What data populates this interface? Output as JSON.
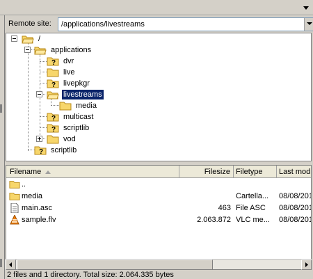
{
  "remote": {
    "label": "Remote site:",
    "path": "/applications/livestreams"
  },
  "tree": {
    "nodes": [
      {
        "label": "/",
        "icon": "folder-open-icon",
        "expanded": true
      },
      {
        "label": "applications",
        "icon": "folder-open-icon",
        "expanded": true
      },
      {
        "label": "dvr",
        "icon": "folder-unknown-icon"
      },
      {
        "label": "live",
        "icon": "folder-icon"
      },
      {
        "label": "livepkgr",
        "icon": "folder-unknown-icon"
      },
      {
        "label": "livestreams",
        "icon": "folder-open-icon",
        "expanded": true,
        "selected": true
      },
      {
        "label": "media",
        "icon": "folder-icon"
      },
      {
        "label": "multicast",
        "icon": "folder-unknown-icon"
      },
      {
        "label": "scriptlib",
        "icon": "folder-unknown-icon"
      },
      {
        "label": "vod",
        "icon": "folder-icon",
        "expanded": false
      },
      {
        "label": "scriptlib",
        "icon": "folder-unknown-icon"
      }
    ]
  },
  "list": {
    "columns": [
      {
        "label": "Filename",
        "sort": "ascending"
      },
      {
        "label": "Filesize"
      },
      {
        "label": "Filetype"
      },
      {
        "label": "Last modi"
      }
    ],
    "rows": [
      {
        "name": "..",
        "size": "",
        "type": "",
        "modified": "",
        "icon": "folder-icon"
      },
      {
        "name": "media",
        "size": "",
        "type": "Cartella...",
        "modified": "08/08/201",
        "icon": "folder-icon"
      },
      {
        "name": "main.asc",
        "size": "463",
        "type": "File ASC",
        "modified": "08/08/201",
        "icon": "text-file-icon"
      },
      {
        "name": "sample.flv",
        "size": "2.063.872",
        "type": "VLC me...",
        "modified": "08/08/201",
        "icon": "vlc-cone-icon"
      }
    ]
  },
  "status": {
    "text": "2 files and 1 directory. Total size: 2.064.335 bytes"
  },
  "colors": {
    "selection": "#0a246a",
    "folder": "#f7d66b",
    "vlc": "#f08000"
  }
}
